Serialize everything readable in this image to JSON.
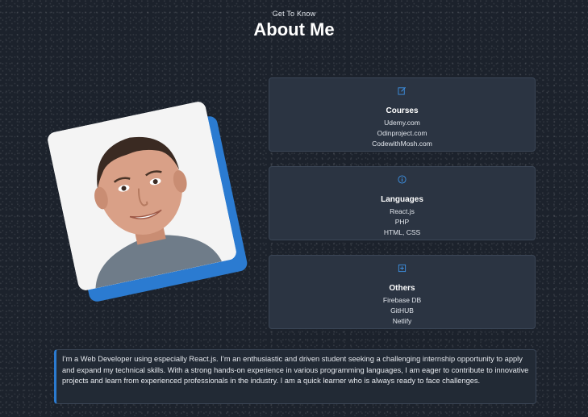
{
  "header": {
    "subtitle": "Get To Know",
    "title": "About Me"
  },
  "colors": {
    "accent": "#2b7bd1",
    "background": "#1c222c",
    "card": "#2b3442"
  },
  "cards": [
    {
      "icon": "edit-icon",
      "title": "Courses",
      "items": [
        "Udemy.com",
        "Odinproject.com",
        "CodewithMosh.com"
      ]
    },
    {
      "icon": "info-icon",
      "title": "Languages",
      "items": [
        "React.js",
        "PHP",
        "HTML, CSS"
      ]
    },
    {
      "icon": "plus-square-icon",
      "title": "Others",
      "items": [
        "Firebase DB",
        "GitHUB",
        "Netlify"
      ]
    }
  ],
  "bio": "I’m a Web Developer using especially React.js. I’m an enthusiastic and driven student seeking a challenging internship opportunity to apply and expand my technical skills. With a strong hands-on experience in various programming languages, I am eager to contribute to innovative projects and learn from experienced professionals in the industry. I am a quick learner who is always ready to face challenges."
}
